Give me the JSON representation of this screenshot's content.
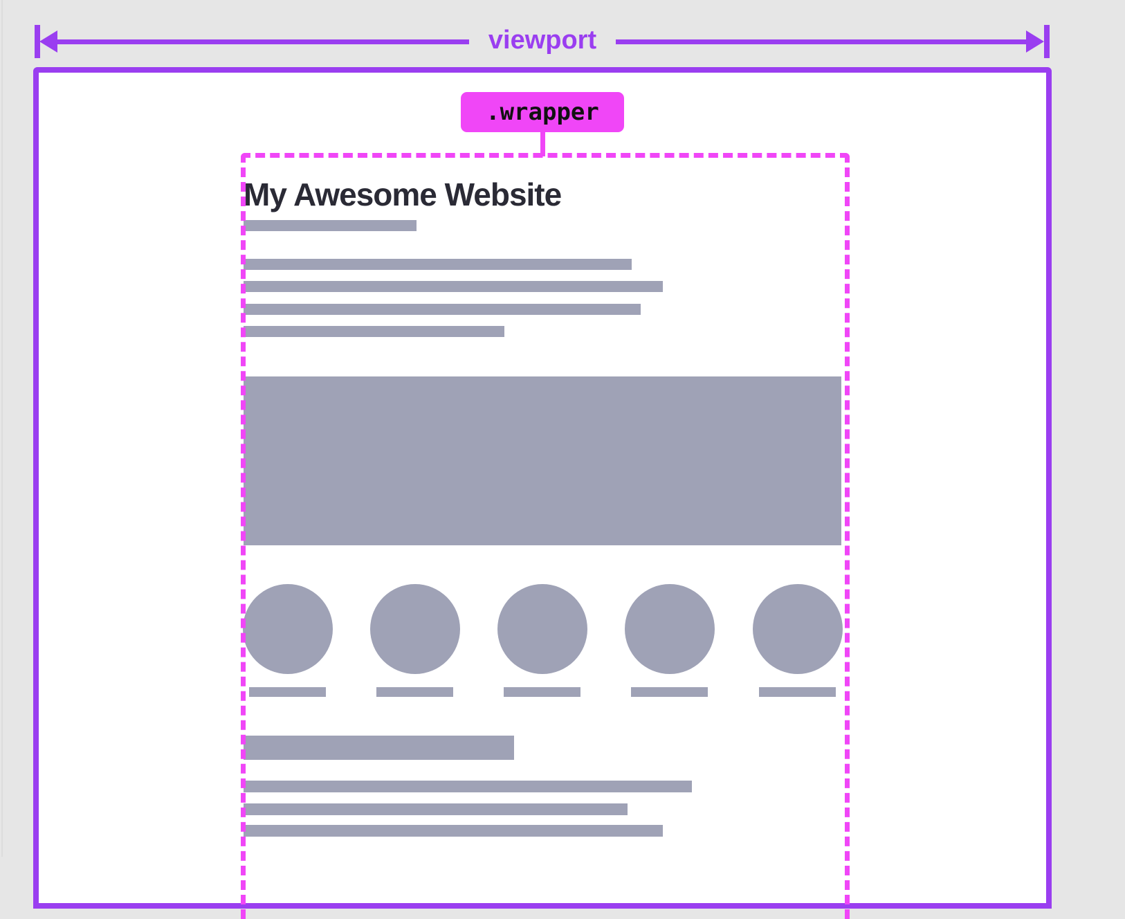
{
  "diagram": {
    "viewport_label": "viewport",
    "wrapper_label": ".wrapper",
    "heading": "My Awesome Website",
    "gallery_item_count": 5,
    "colors": {
      "viewport_accent": "#9a3ef0",
      "wrapper_accent": "#f046f7",
      "placeholder": "#9fa2b6",
      "heading_text": "#2a2a35",
      "page_background": "#ffffff",
      "canvas_background": "#e6e6e6"
    }
  }
}
